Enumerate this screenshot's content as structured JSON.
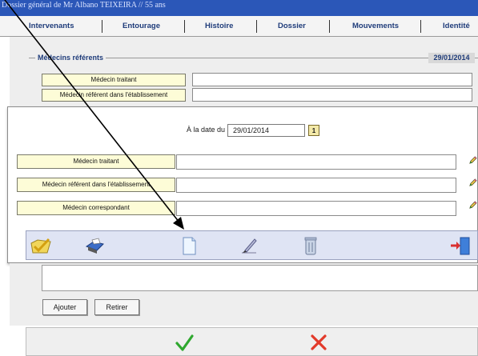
{
  "window": {
    "title": "Dossier général de Mr Albano TEIXEIRA  // 55 ans"
  },
  "tabs": [
    {
      "label": "Intervenants"
    },
    {
      "label": "Entourage"
    },
    {
      "label": "Histoire"
    },
    {
      "label": "Dossier"
    },
    {
      "label": "Mouvements"
    },
    {
      "label": "Identité"
    }
  ],
  "background": {
    "group_title": "Médecins référents",
    "date": "29/01/2014",
    "rows": [
      {
        "label": "Médecin traitant",
        "value": ""
      },
      {
        "label": "Médecin référent dans l'établissement",
        "value": ""
      }
    ]
  },
  "dialog": {
    "date_label": "À la date du",
    "date_value": "29/01/2014",
    "rows": [
      {
        "label": "Médecin traitant",
        "value": ""
      },
      {
        "label": "Médecin référent dans l'établissement",
        "value": ""
      },
      {
        "label": "Médecin correspondant",
        "value": ""
      }
    ],
    "toolbar": [
      {
        "icon": "check-folder-icon"
      },
      {
        "icon": "printer-icon"
      },
      {
        "icon": "new-document-icon"
      },
      {
        "icon": "edit-pen-icon"
      },
      {
        "icon": "trash-icon"
      },
      {
        "icon": "exit-door-icon"
      }
    ]
  },
  "lower": {
    "add_label": "Ajouter",
    "remove_label": "Retirer"
  },
  "colors": {
    "title_bar": "#2b57b8",
    "tab_text": "#1f3c7a",
    "label_button": "#fdfcd7",
    "toolbar": "#dfe4f4",
    "confirm": "#2fa82f",
    "cancel": "#e23a2a"
  }
}
